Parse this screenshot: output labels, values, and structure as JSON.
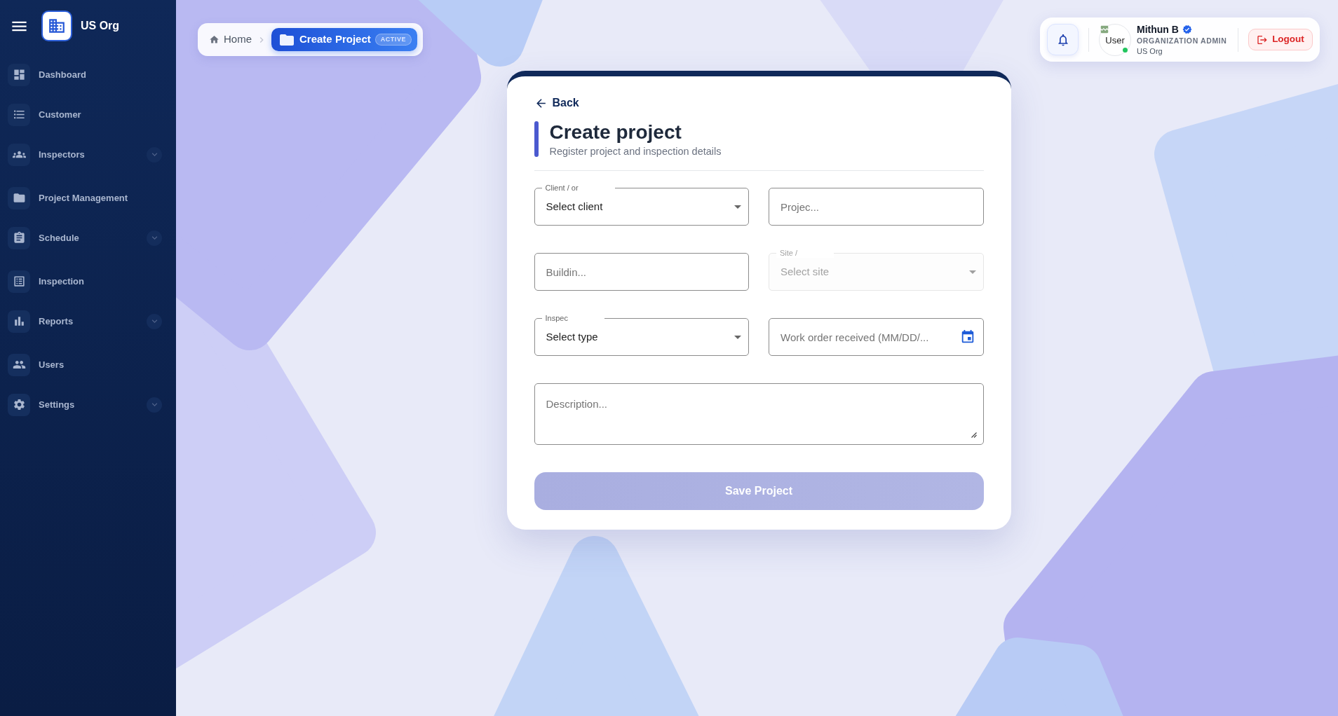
{
  "sidebar": {
    "org_name": "US Org",
    "items": [
      {
        "label": "Dashboard",
        "kind": "link"
      },
      {
        "label": "Customer",
        "kind": "link"
      },
      {
        "label": "Inspectors",
        "kind": "group"
      },
      {
        "label": "Project Management",
        "kind": "link"
      },
      {
        "label": "Schedule",
        "kind": "group"
      },
      {
        "label": "Inspection",
        "kind": "link"
      },
      {
        "label": "Reports",
        "kind": "group"
      },
      {
        "label": "Users",
        "kind": "link"
      },
      {
        "label": "Settings",
        "kind": "group"
      }
    ]
  },
  "breadcrumb": [
    {
      "label": "Home",
      "selected": false
    },
    {
      "label": "Create Project",
      "selected": true,
      "badge": "ACTIVE"
    }
  ],
  "user_panel": {
    "avatar_alt": "User",
    "online": true,
    "name": "Mithun B",
    "verified": true,
    "role": "ORGANIZATION ADMIN",
    "org": "US Org",
    "logout_label": "Logout"
  },
  "form": {
    "back_label": "Back",
    "title": "Create project",
    "subtitle": "Register project and inspection details",
    "fields": [
      {
        "kind": "select",
        "label": "Client / or",
        "value": "Select client",
        "disabled": false
      },
      {
        "kind": "text",
        "placeholder": "Projec...",
        "disabled": false
      },
      {
        "kind": "text",
        "placeholder": "Buildin...",
        "disabled": false
      },
      {
        "kind": "select",
        "label": "Site /",
        "value": "Select site",
        "disabled": true
      },
      {
        "kind": "select",
        "label": "Inspec",
        "value": "Select type",
        "disabled": false
      },
      {
        "kind": "date",
        "placeholder": "Work order received (MM/DD/...",
        "disabled": false
      },
      {
        "kind": "textarea",
        "placeholder": "Description...",
        "disabled": false
      }
    ],
    "submit": {
      "label": "Save Project",
      "disabled": true
    }
  }
}
